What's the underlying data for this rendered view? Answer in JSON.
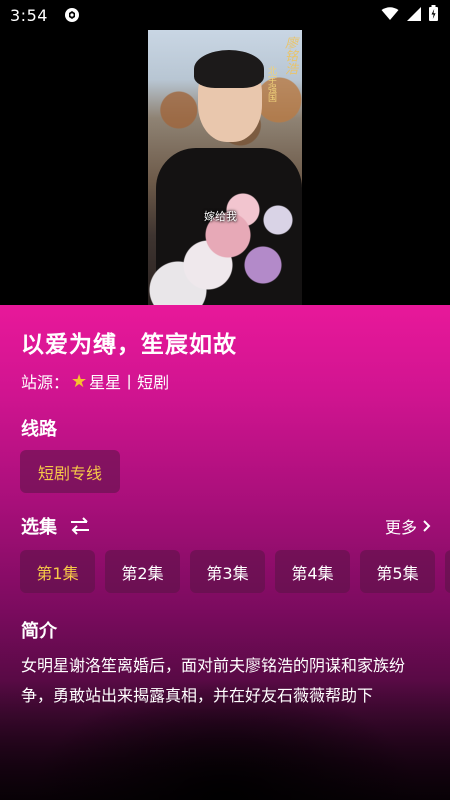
{
  "status_bar": {
    "time": "3:54",
    "icons": [
      "app-notification-icon",
      "wifi-icon",
      "signal-icon",
      "battery-icon"
    ]
  },
  "video": {
    "caption": "嫁给我",
    "watermark_main": "廖铭浩",
    "watermark_sub": "北宇强国"
  },
  "drama": {
    "title": "以爱为缚，笙宸如故",
    "source_label": "站源：",
    "source_name": "星星丨短剧"
  },
  "line_section": {
    "heading": "线路",
    "selected_line": "短剧专线"
  },
  "episodes_section": {
    "heading": "选集",
    "more_label": "更多",
    "episodes": [
      "第1集",
      "第2集",
      "第3集",
      "第4集",
      "第5集"
    ],
    "active_index": 0
  },
  "synopsis_section": {
    "heading": "简介",
    "text": "女明星谢洛笙离婚后，面对前夫廖铭浩的阴谋和家族纷争，勇敢站出来揭露真相，并在好友石薇薇帮助下"
  },
  "colors": {
    "accent_gold": "#f7c948",
    "panel_top": "#e8189a",
    "panel_bottom": "#200418"
  }
}
